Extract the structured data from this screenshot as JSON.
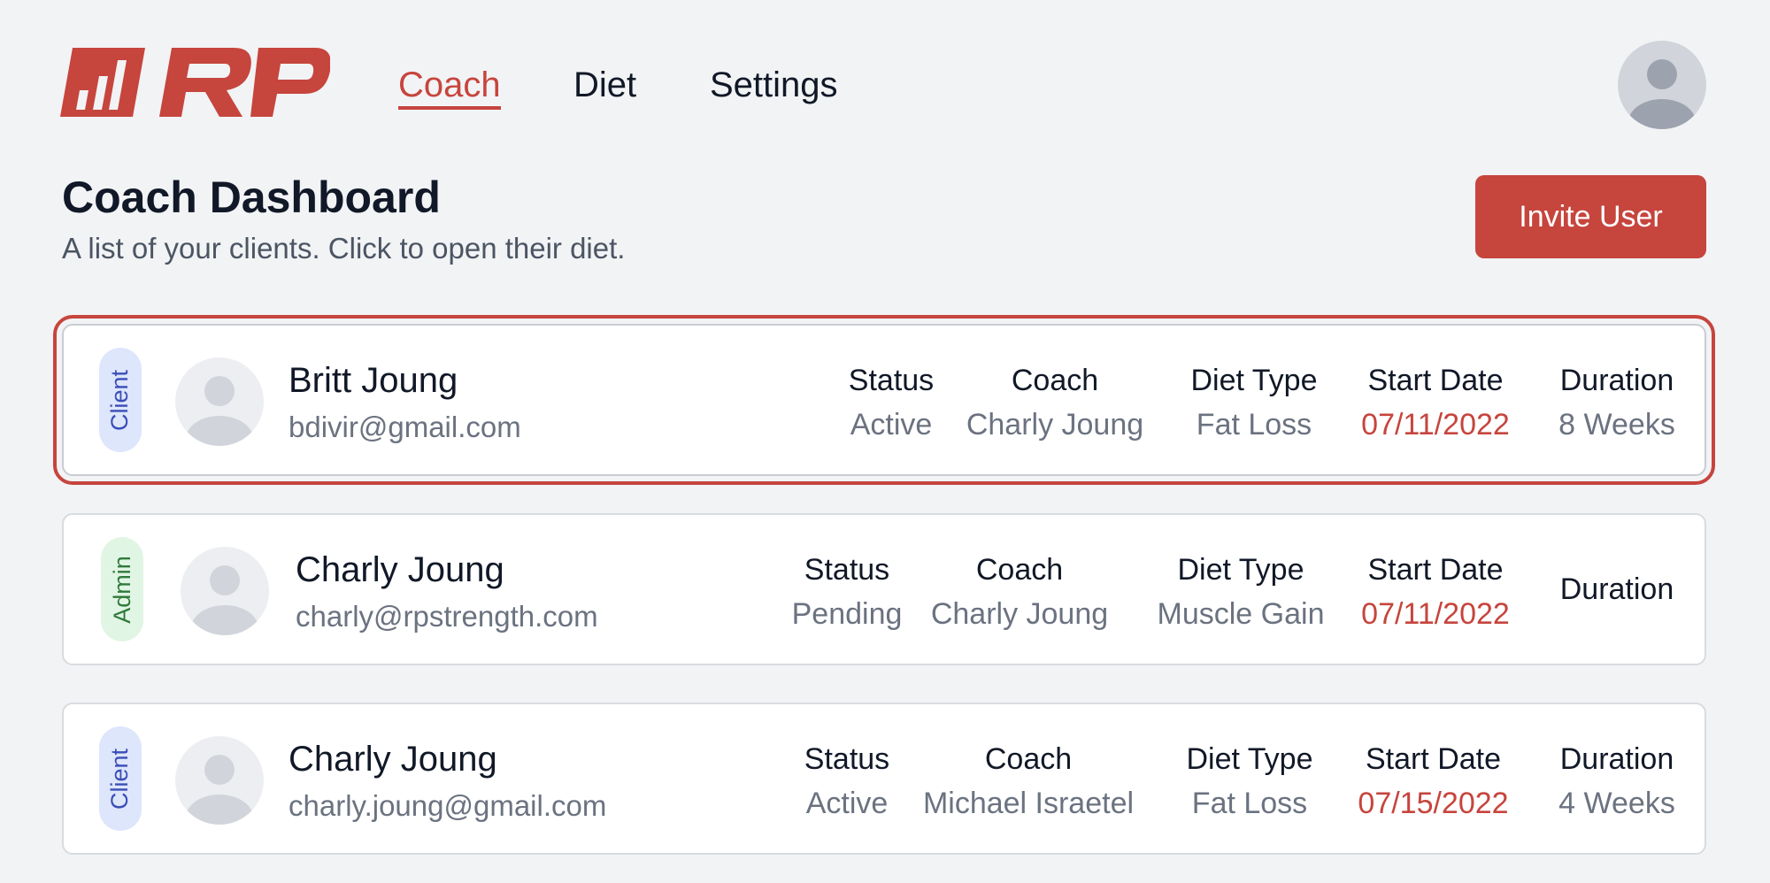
{
  "nav": {
    "logo_text": "RP",
    "links": [
      "Coach",
      "Diet",
      "Settings"
    ],
    "active": "Coach"
  },
  "page": {
    "title": "Coach Dashboard",
    "subtitle": "A list of your clients. Click to open their diet.",
    "invite_label": "Invite User"
  },
  "columns": {
    "status": "Status",
    "coach": "Coach",
    "diet_type": "Diet Type",
    "start_date": "Start Date",
    "duration": "Duration"
  },
  "clients": [
    {
      "role": "Client",
      "name": "Britt Joung",
      "email": "bdivir@gmail.com",
      "status": "Active",
      "coach": "Charly Joung",
      "diet_type": "Fat Loss",
      "start_date": "07/11/2022",
      "duration": "8 Weeks",
      "selected": true
    },
    {
      "role": "Admin",
      "name": "Charly Joung",
      "email": "charly@rpstrength.com",
      "status": "Pending",
      "coach": "Charly Joung",
      "diet_type": "Muscle Gain",
      "start_date": "07/11/2022",
      "duration": "",
      "selected": false
    },
    {
      "role": "Client",
      "name": "Charly Joung",
      "email": "charly.joung@gmail.com",
      "status": "Active",
      "coach": "Michael Israetel",
      "diet_type": "Fat Loss",
      "start_date": "07/15/2022",
      "duration": "4 Weeks",
      "selected": false
    }
  ],
  "colors": {
    "accent": "#c6453d",
    "client_badge_bg": "#dde6fb",
    "admin_badge_bg": "#e1f5e4"
  }
}
